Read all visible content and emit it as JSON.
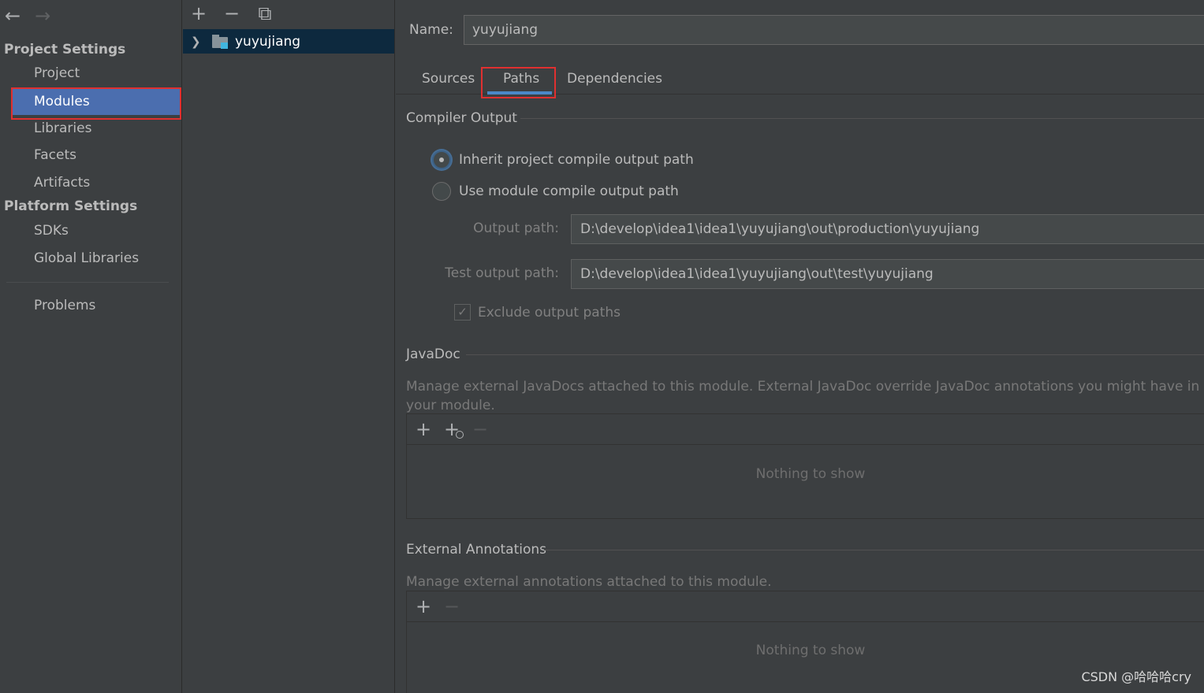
{
  "sidebar": {
    "project_settings_title": "Project Settings",
    "project_settings_items": [
      "Project",
      "Modules",
      "Libraries",
      "Facets",
      "Artifacts"
    ],
    "platform_settings_title": "Platform Settings",
    "platform_settings_items": [
      "SDKs",
      "Global Libraries"
    ],
    "problems": "Problems",
    "selected": "Modules"
  },
  "tree": {
    "module_name": "yuyujiang"
  },
  "main": {
    "name_label": "Name:",
    "name_value": "yuyujiang",
    "tabs": [
      "Sources",
      "Paths",
      "Dependencies"
    ],
    "active_tab": "Paths",
    "compiler_output": {
      "title": "Compiler Output",
      "inherit_label": "Inherit project compile output path",
      "use_module_label": "Use module compile output path",
      "output_path_label": "Output path:",
      "output_path_value": "D:\\develop\\idea1\\idea1\\yuyujiang\\out\\production\\yuyujiang",
      "test_output_path_label": "Test output path:",
      "test_output_path_value": "D:\\develop\\idea1\\idea1\\yuyujiang\\out\\test\\yuyujiang",
      "exclude_label": "Exclude output paths"
    },
    "javadoc": {
      "title": "JavaDoc",
      "description": "Manage external JavaDocs attached to this module. External JavaDoc override JavaDoc annotations you might have in your module.",
      "empty": "Nothing to show"
    },
    "external_annotations": {
      "title": "External Annotations",
      "description": "Manage external annotations attached to this module.",
      "empty": "Nothing to show"
    }
  },
  "watermark": "CSDN @哈哈哈cry",
  "colors": {
    "selection": "#4b6eaf",
    "highlight_box": "#e03030",
    "tab_underline": "#4a88c7"
  }
}
